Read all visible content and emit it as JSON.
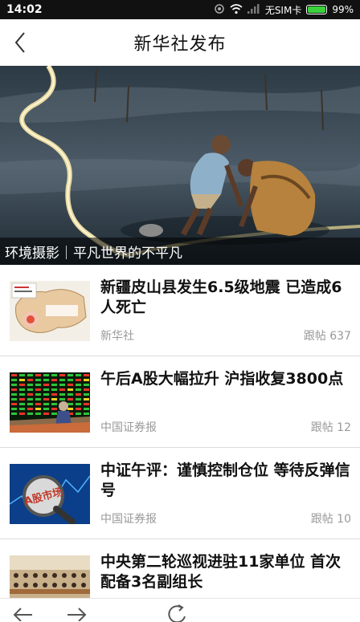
{
  "status_bar": {
    "time": "14:02",
    "carrier": "无SIM卡",
    "battery_percent": "99%",
    "battery_level": 0.99,
    "icons": [
      "notification-icon",
      "wifi-icon",
      "signal-icon",
      "battery-icon"
    ]
  },
  "header": {
    "title": "新华社发布",
    "back_icon": "chevron-left-icon"
  },
  "hero": {
    "caption": "环境摄影｜平凡世界的不平凡"
  },
  "news": [
    {
      "headline": "新疆皮山县发生6.5级地震 已造成6人死亡",
      "source": "新华社",
      "replies": "跟帖 637"
    },
    {
      "headline": "午后A股大幅拉升 沪指收复3800点",
      "source": "中国证券报",
      "replies": "跟帖 12"
    },
    {
      "headline": "中证午评：谨慎控制仓位 等待反弹信号",
      "source": "中国证券报",
      "replies": "跟帖 10"
    },
    {
      "headline": "中央第二轮巡视进驻11家单位 首次配备3名副组长",
      "source": "",
      "replies": ""
    }
  ],
  "thumbnail_text": {
    "market_sign": "A股市场"
  },
  "bottom_bar": {
    "icons": [
      "back-arrow-icon",
      "forward-arrow-icon",
      "refresh-icon"
    ]
  },
  "colors": {
    "status_bar_bg": "#111111",
    "battery_green": "#3bd13b",
    "divider": "#dcdcdc",
    "meta_text": "#999999"
  }
}
